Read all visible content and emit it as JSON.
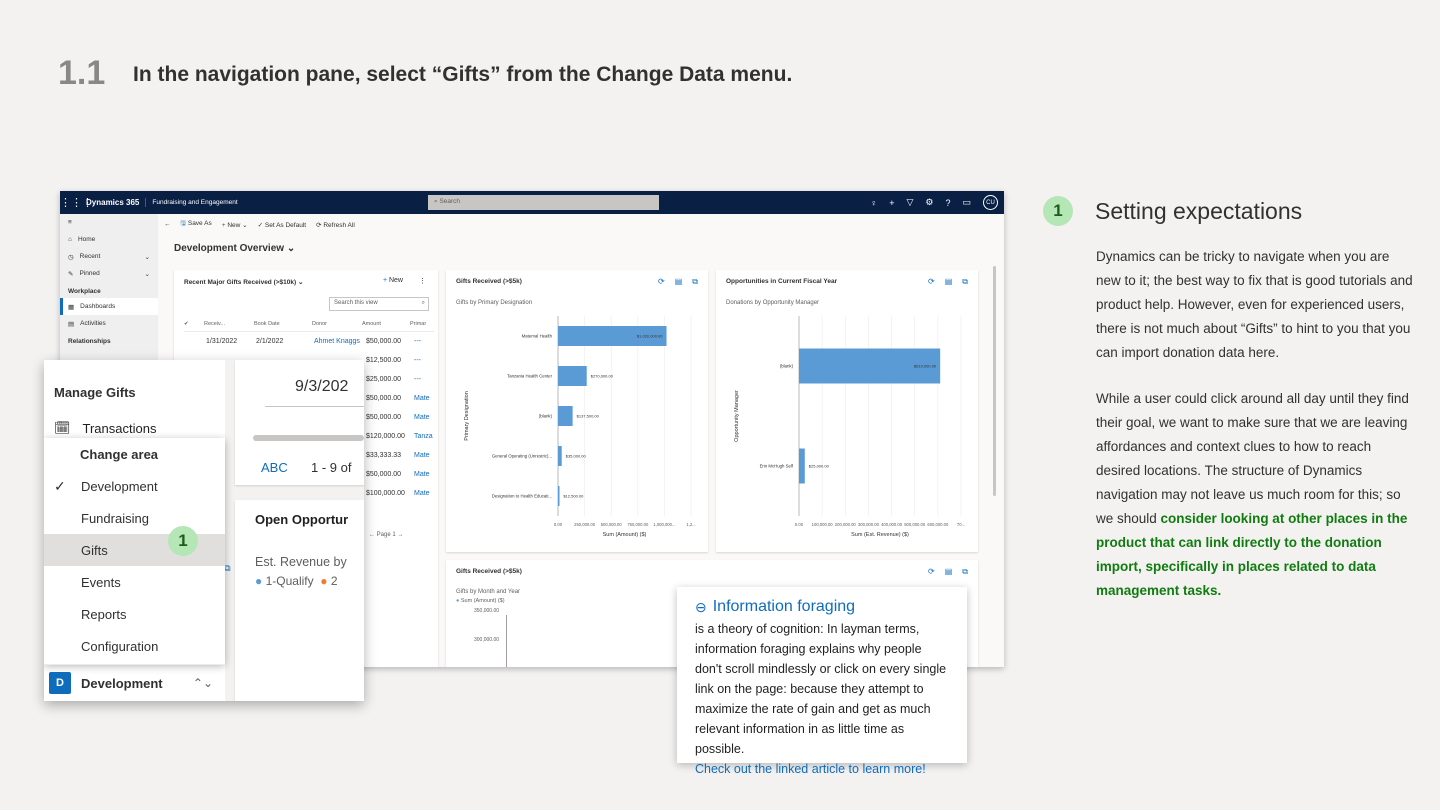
{
  "step": {
    "number": "1.1",
    "title": "In the navigation pane, select “Gifts” from the Change Data menu."
  },
  "app": {
    "brand": "Dynamics 365",
    "app_name": "Fundraising and Engagement",
    "search_placeholder": "Search",
    "user_initials": "CU",
    "nav": {
      "home": "Home",
      "recent": "Recent",
      "pinned": "Pinned",
      "workplace": "Workplace",
      "dashboards": "Dashboards",
      "activities": "Activities",
      "relationships": "Relationships"
    },
    "commands": {
      "save_as": "Save As",
      "new": "New",
      "set_default": "Set As Default",
      "refresh_all": "Refresh All"
    },
    "dashboard_title": "Development Overview",
    "gifts_list": {
      "title": "Recent Major Gifts Received (>$10k)",
      "new_label": "New",
      "search_placeholder": "Search this view",
      "columns": [
        "Receiv...",
        "Book Date",
        "Donor",
        "Amount",
        "Primar"
      ],
      "rows": [
        {
          "received": "1/31/2022",
          "book": "2/1/2022",
          "donor": "Ahmet Knaggs",
          "amount": "$50,000.00",
          "primary": "---"
        },
        {
          "received": "",
          "book": "",
          "donor": "",
          "amount": "$12,500.00",
          "primary": "---"
        },
        {
          "received": "",
          "book": "",
          "donor": "",
          "amount": "$25,000.00",
          "primary": "---"
        },
        {
          "received": "",
          "book": "",
          "donor": "",
          "amount": "$50,000.00",
          "primary": "Mate"
        },
        {
          "received": "",
          "book": "",
          "donor": "",
          "amount": "$50,000.00",
          "primary": "Mate"
        },
        {
          "received": "",
          "book": "",
          "donor": "",
          "amount": "$120,000.00",
          "primary": "Tanza"
        },
        {
          "received": "",
          "book": "",
          "donor": "",
          "amount": "$33,333.33",
          "primary": "Mate"
        },
        {
          "received": "",
          "book": "",
          "donor": "",
          "amount": "$50,000.00",
          "primary": "Mate"
        },
        {
          "received": "",
          "book": "",
          "donor": "",
          "amount": "$100,000.00",
          "primary": "Mate"
        }
      ],
      "page_label": "Page 1"
    },
    "gifts_chart": {
      "title": "Gifts Received (>$5k)",
      "subtitle": "Gifts by Primary Designation"
    },
    "opp_chart": {
      "title": "Opportunities in Current Fiscal Year",
      "subtitle": "Donations by Opportunity Manager"
    },
    "gifts_month": {
      "title": "Gifts Received (>$5k)",
      "subtitle": "Gifts by Month and Year",
      "legend": "Sum (Amount) ($)",
      "ticks": [
        "350,000.00",
        "300,000.00"
      ]
    }
  },
  "chart_data": [
    {
      "type": "bar",
      "orientation": "horizontal",
      "categories": [
        "Maternal Health",
        "Tanzania Health Center",
        "(blank)",
        "General Operating (Unrestric)...",
        "Designation to Health Educati..."
      ],
      "values": [
        1020000,
        270000,
        137500,
        35000,
        12500
      ],
      "value_labels": [
        "$1,020,000.00",
        "$270,000.00",
        "$137,500.00",
        "$35,000.00",
        "$12,500.00"
      ],
      "xlabel": "Sum (Amount) ($)",
      "ylabel": "Primary Designation",
      "xlim": [
        0,
        1250000
      ],
      "x_ticks": [
        "0.00",
        "250,000.00",
        "500,000.00",
        "750,000.00",
        "1,000,000...",
        "1,2..."
      ]
    },
    {
      "type": "bar",
      "orientation": "horizontal",
      "categories": [
        "(blank)",
        "Erin McHugh Self"
      ],
      "values": [
        610000,
        25000
      ],
      "value_labels": [
        "$610,000.00",
        "$25,000.00"
      ],
      "xlabel": "Sum (Est. Revenue) ($)",
      "ylabel": "Opportunity Manager",
      "xlim": [
        0,
        700000
      ],
      "x_ticks": [
        "0.00",
        "100,000.00",
        "200,000.00",
        "300,000.00",
        "400,000.00",
        "500,000.00",
        "600,000.00",
        "70..."
      ]
    }
  ],
  "popup": {
    "heading": "Manage Gifts",
    "transactions": "Transactions",
    "change_area": "Change area",
    "areas": [
      "Development",
      "Fundraising",
      "Gifts",
      "Events",
      "Reports",
      "Configuration"
    ],
    "checked_area": "Development",
    "highlighted_area": "Gifts",
    "current_area": "Development",
    "current_initial": "D",
    "date": "9/3/202",
    "abc": "ABC",
    "count": "1 - 9 of",
    "open_opps": "Open Opportur",
    "est_revenue": "Est. Revenue by",
    "legend1": "1-Qualify",
    "legend2": "2",
    "badge": "1"
  },
  "tip": {
    "title": "Information foraging",
    "body": "is a theory of cognition: In layman terms, information foraging explains why people don't scroll mindlessly or click on every single link on the page: because they attempt to maximize the rate of gain and get as much relevant information in as little time as possible.",
    "link": "Check out the linked article to learn more!"
  },
  "side": {
    "badge": "1",
    "title": "Setting expectations",
    "para1": "Dynamics can be tricky to navigate when you are new to it; the best way to fix that is good tutorials and product help. However, even for experienced users, there is not much about “Gifts” to hint to you that you can import donation data here.",
    "para2_plain": "While a user could click around all day until they find their goal, we want to make sure that we are leaving affordances and context clues to how to reach desired locations. The structure of Dynamics navigation may not leave us much room for this; so we should ",
    "para2_green": "consider looking at other places in the product that can link directly to the donation import, specifically in places related to data management tasks."
  },
  "colors": {
    "bar": "#5b9bd5",
    "accent": "#0f6cbd",
    "green": "#107c10",
    "badge": "#b5e6b5",
    "topbar": "#0a1f44"
  }
}
